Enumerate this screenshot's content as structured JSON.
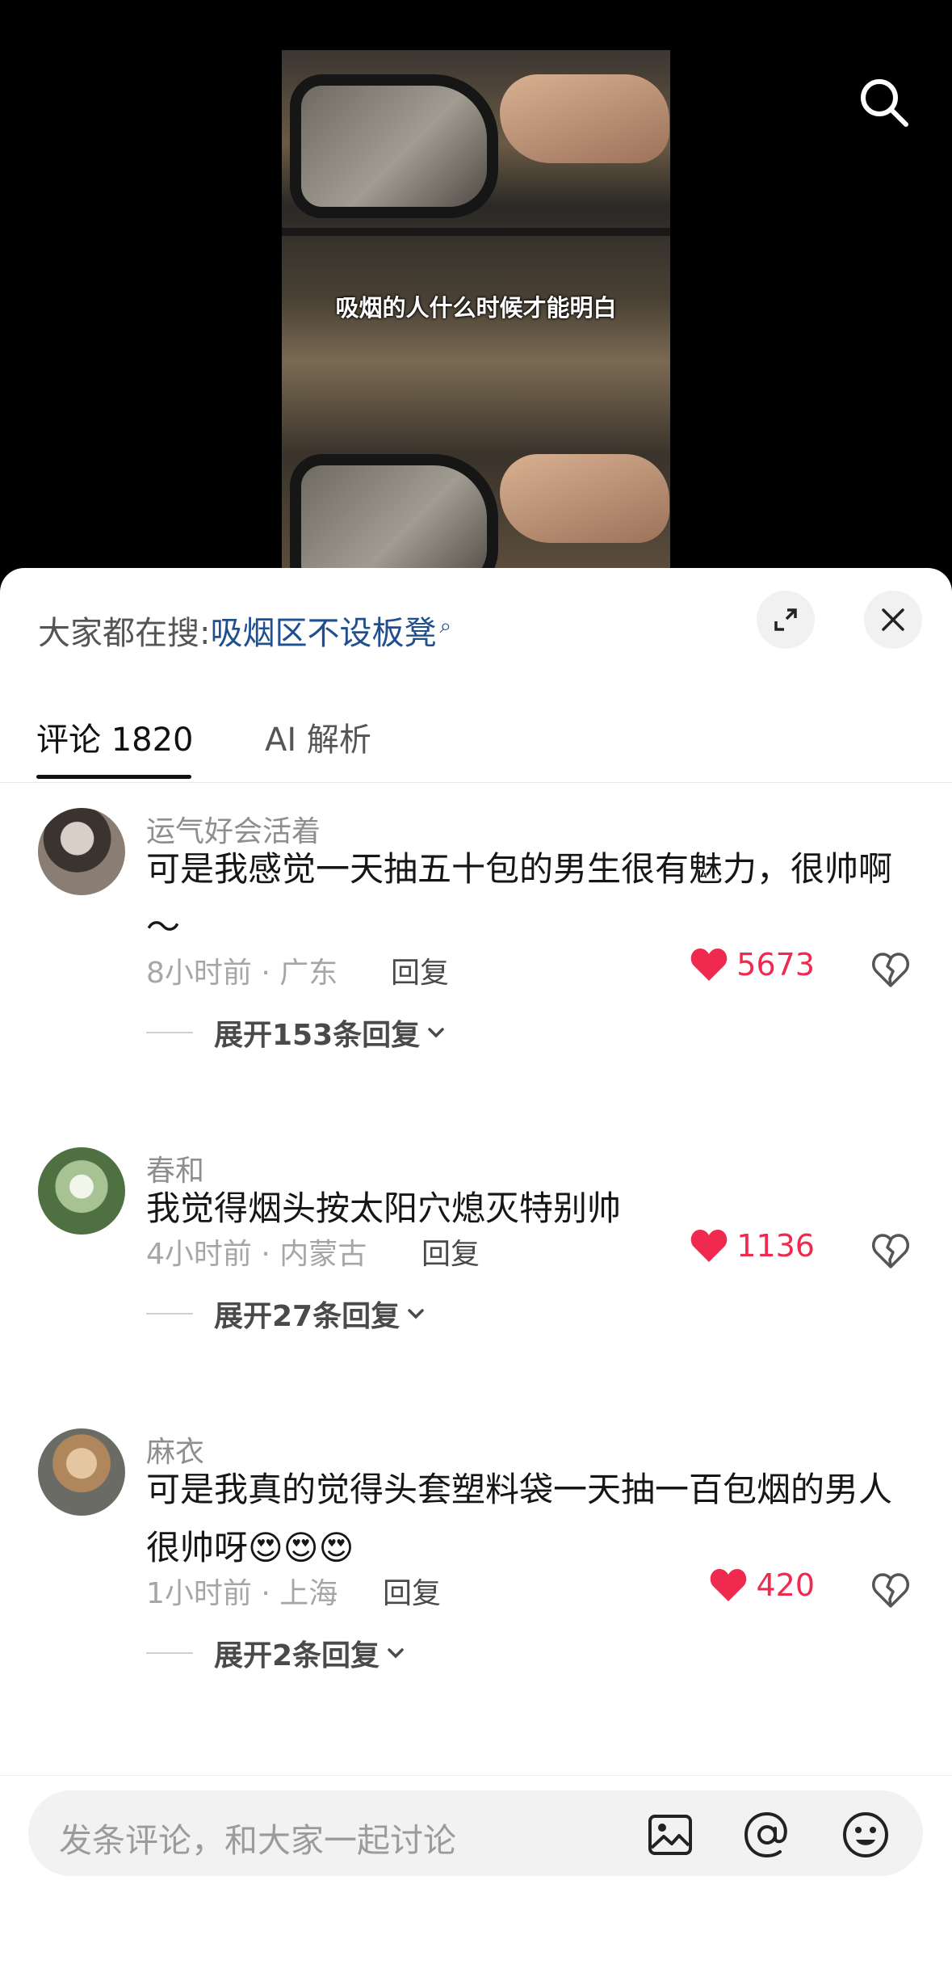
{
  "video": {
    "caption": "吸烟的人什么时候才能明白"
  },
  "sheet": {
    "trending_prefix": "大家都在搜:",
    "trending_query": "吸烟区不设板凳",
    "tabs": [
      {
        "label": "评论 1820",
        "active": true
      },
      {
        "label": "AI 解析",
        "active": false
      }
    ]
  },
  "comments": [
    {
      "username": "运气好会活着",
      "text": "可是我感觉一天抽五十包的男生很有魅力，很帅啊～",
      "time": "8小时前 · 广东",
      "reply_label": "回复",
      "likes": "5673",
      "expand_label": "展开153条回复"
    },
    {
      "username": "春和",
      "text": "我觉得烟头按太阳穴熄灭特别帅",
      "time": "4小时前 · 内蒙古",
      "reply_label": "回复",
      "likes": "1136",
      "expand_label": "展开27条回复"
    },
    {
      "username": "麻衣",
      "text": "可是我真的觉得头套塑料袋一天抽一百包烟的男人很帅呀😍😍😍",
      "time": "1小时前 · 上海",
      "reply_label": "回复",
      "likes": "420",
      "expand_label": "展开2条回复"
    }
  ],
  "input": {
    "placeholder": "发条评论，和大家一起讨论"
  },
  "colors": {
    "like": "#f0294f",
    "link": "#1f4f8f",
    "sheet_bg": "#ffffff"
  }
}
